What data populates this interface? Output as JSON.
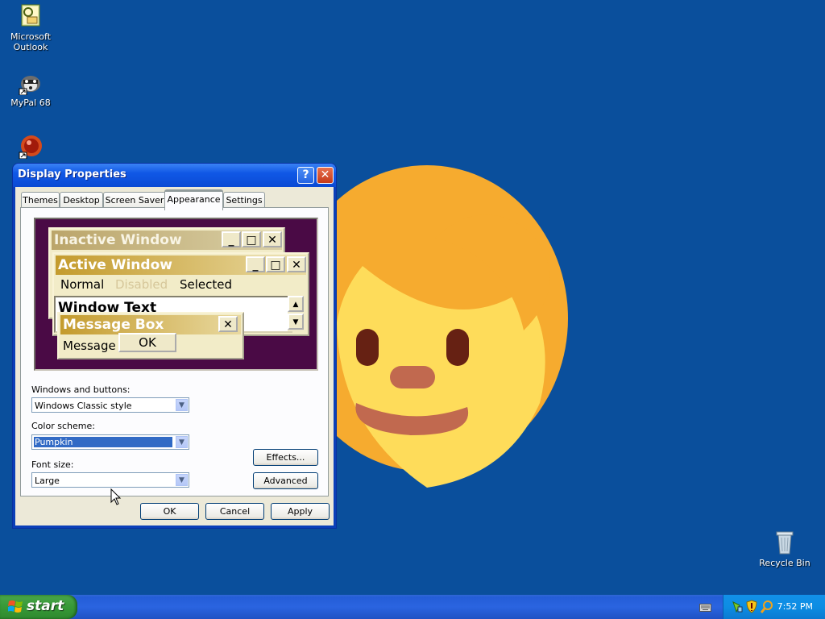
{
  "desktop": {
    "icons": [
      {
        "label": "Microsoft Outlook"
      },
      {
        "label": "MyPal 68"
      },
      {
        "label": ""
      },
      {
        "label": "Recycle Bin"
      }
    ]
  },
  "window": {
    "title": "Display Properties",
    "help_label": "?",
    "close_label": "✕",
    "tabs": [
      {
        "label": "Themes"
      },
      {
        "label": "Desktop"
      },
      {
        "label": "Screen Saver"
      },
      {
        "label": "Appearance"
      },
      {
        "label": "Settings"
      }
    ],
    "active_tab": "Appearance",
    "preview": {
      "inactive_title": "Inactive Window",
      "active_title": "Active Window",
      "menu_normal": "Normal",
      "menu_disabled": "Disabled",
      "menu_selected": "Selected",
      "window_text": "Window Text",
      "msgbox_title": "Message Box",
      "msgbox_text": "Message Text",
      "msgbox_ok": "OK",
      "btn_min": "_",
      "btn_max": "□",
      "btn_close": "✕",
      "scroll_up": "▲",
      "scroll_down": "▼",
      "colors": {
        "background": "#4a0a45",
        "title_gradient_start": "#c49b2d",
        "title_gradient_end": "#e9d9a0",
        "face": "#f2ecc8"
      }
    },
    "windows_and_buttons_label": "Windows and buttons:",
    "windows_and_buttons_value": "Windows Classic style",
    "color_scheme_label": "Color scheme:",
    "color_scheme_value": "Pumpkin",
    "font_size_label": "Font size:",
    "font_size_value": "Large",
    "effects_label": "Effects...",
    "advanced_label": "Advanced",
    "ok_label": "OK",
    "cancel_label": "Cancel",
    "apply_label": "Apply"
  },
  "taskbar": {
    "start_label": "start",
    "clock": "7:52 PM"
  }
}
